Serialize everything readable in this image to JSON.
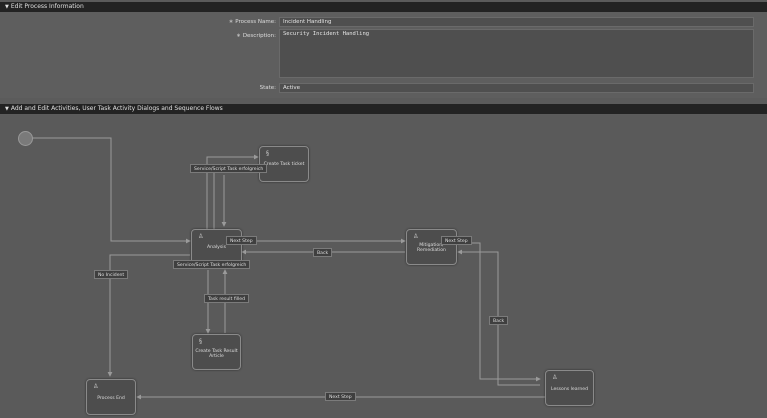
{
  "process_section": {
    "title": "Edit Process Information",
    "name_label": "Process Name:",
    "name_value": "Incident Handling",
    "description_label": "Description:",
    "description_value": "Security Incident Handling",
    "state_label": "State:",
    "state_value": "Active",
    "required_marker": "∗"
  },
  "activities_section": {
    "title": "Add and Edit Activities, User Task Activity Dialogs and Sequence Flows"
  },
  "tasks": {
    "create_ticket": {
      "label": "Create Task ticket",
      "icon": "script-icon"
    },
    "analysis": {
      "label": "Analysis",
      "icon": "user-icon"
    },
    "mitigation": {
      "label": "Mitigation/ Remediation",
      "icon": "user-icon"
    },
    "create_result": {
      "label": "Create Task Result Article",
      "icon": "script-icon"
    },
    "lessons": {
      "label": "Lessons learned",
      "icon": "user-icon"
    },
    "process_end": {
      "label": "Process End",
      "icon": "user-icon"
    }
  },
  "flow_labels": {
    "service_top": "Service/Script Task erfolgreich",
    "service_mid": "Service/Script Task erfolgreich",
    "next_step_1": "Next Step",
    "next_step_2": "Next Step",
    "next_step_3": "Next Step",
    "back_1": "Back",
    "back_2": "Back",
    "no_incident": "No Incident",
    "task_result_filled": "Task result filled"
  },
  "colors": {
    "header_bg": "#232323",
    "canvas_bg": "#5a5a5a",
    "task_bg": "#4d4d4d",
    "line": "#9a9a9a"
  }
}
